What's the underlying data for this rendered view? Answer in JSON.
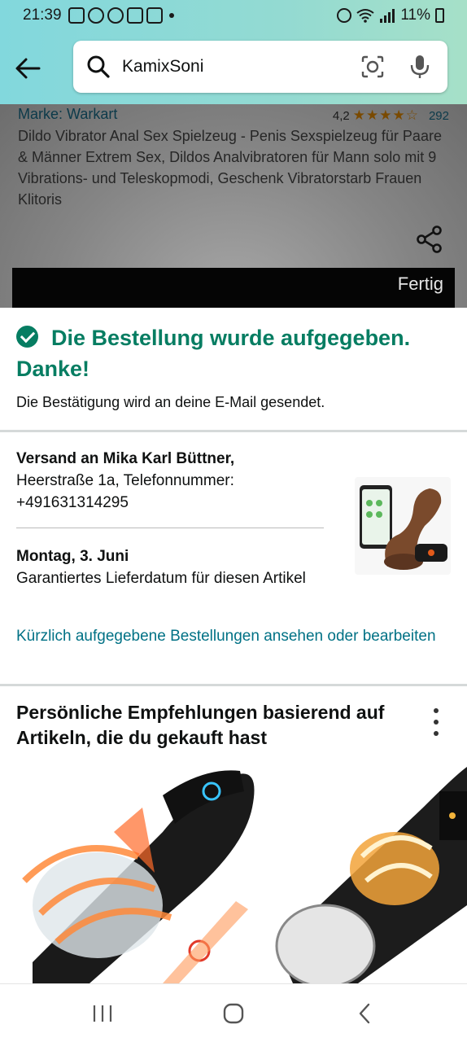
{
  "status_bar": {
    "time": "21:39",
    "battery": "11%"
  },
  "search": {
    "query": "KamixSoni"
  },
  "product": {
    "brand": "Marke: Warkart",
    "rating": "4,2",
    "stars": "★★★★☆",
    "review_count": "292",
    "title": "Dildo Vibrator Anal Sex Spielzeug - Penis Sexspielzeug für Paare & Männer Extrem Sex, Dildos Analvibratoren für Mann solo mit 9 Vibrations- und Teleskopmodi, Geschenk Vibratorstarb Frauen Klitoris",
    "done_label": "Fertig"
  },
  "confirmation": {
    "headline": "Die Bestellung wurde aufgegeben. Danke!",
    "email_note": "Die Bestätigung wird an deine E-Mail gesendet.",
    "shipping_label": "Versand an Mika Karl Büttner,",
    "shipping_address": "Heerstraße 1a, Telefonnummer: +491631314295",
    "delivery_date": "Montag, 3. Juni",
    "delivery_note": "Garantiertes Lieferdatum für diesen Artikel",
    "orders_link": "Kürzlich aufgegebene Bestellungen ansehen oder bearbeiten"
  },
  "recommendations": {
    "title": "Persönliche Empfehlungen basierend auf Artikeln, die du gekauft hast"
  },
  "colors": {
    "header_gradient": "#93dad2",
    "success_green": "#067d62",
    "link_teal": "#007185"
  },
  "icons": [
    "back-arrow-icon",
    "search-icon",
    "camera-lens-icon",
    "microphone-icon",
    "share-icon",
    "check-circle-icon",
    "more-vertical-icon",
    "recents-icon",
    "home-icon",
    "nav-back-icon"
  ]
}
